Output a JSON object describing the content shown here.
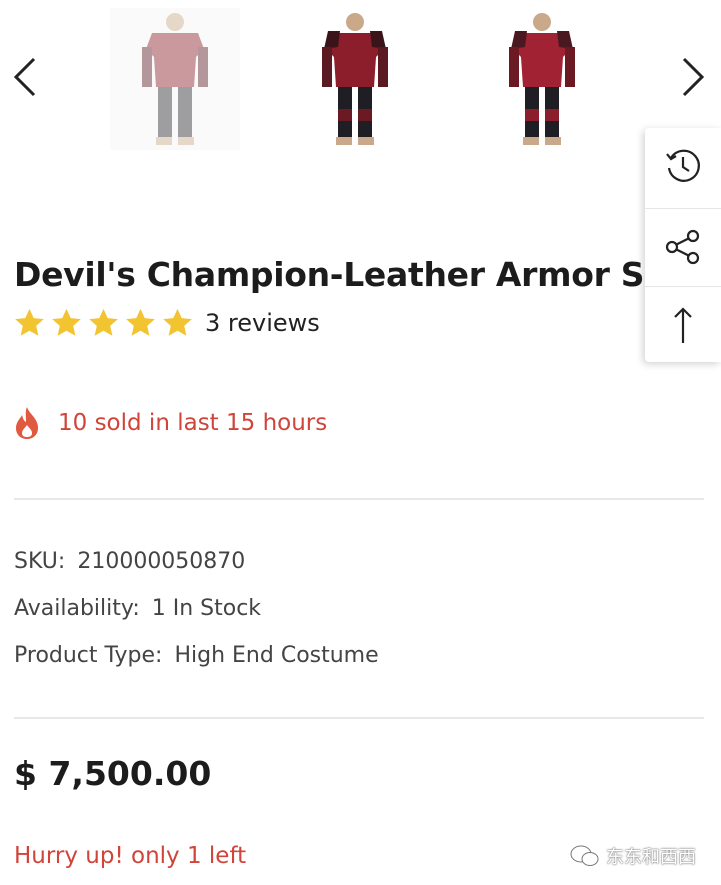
{
  "gallery": {
    "prev_icon": "chevron-left-icon",
    "next_icon": "chevron-right-icon",
    "thumbnails": [
      "armor-front-faded",
      "armor-front",
      "armor-front-alt"
    ]
  },
  "side_tools": [
    {
      "icon": "history-icon"
    },
    {
      "icon": "share-icon"
    },
    {
      "icon": "arrow-up-icon"
    }
  ],
  "product": {
    "title": "Devil's Champion-Leather Armor Set",
    "rating_stars": 5,
    "reviews_label": "3 reviews",
    "sold_text": "10 sold in last 15 hours",
    "sku_label": "SKU:",
    "sku_value": "210000050870",
    "availability_label": "Availability:",
    "availability_value": "1 In Stock",
    "product_type_label": "Product Type:",
    "product_type_value": "High End Costume",
    "price": "$ 7,500.00",
    "stock_warning": "Hurry up! only 1 left"
  },
  "watermark": {
    "text": "东东和西西"
  },
  "colors": {
    "star": "#f2c431",
    "alert_red": "#d0443a",
    "armor_red": "#8b1e2a"
  }
}
